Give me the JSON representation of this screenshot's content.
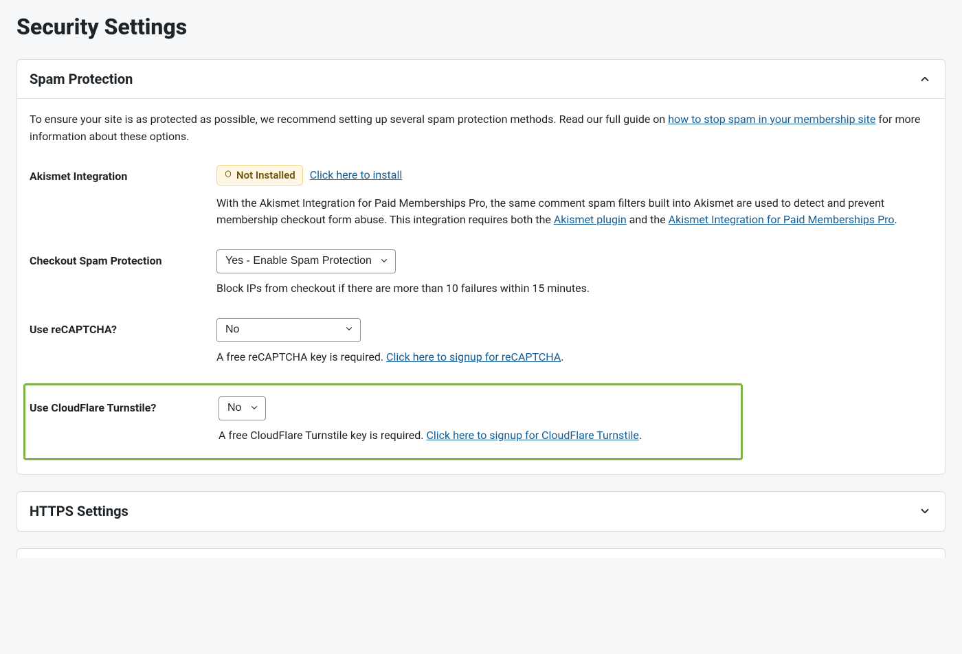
{
  "page": {
    "title": "Security Settings"
  },
  "spam_panel": {
    "title": "Spam Protection",
    "intro_before_link": "To ensure your site is as protected as possible, we recommend setting up several spam protection methods. Read our full guide on ",
    "intro_link": "how to stop spam in your membership site",
    "intro_after_link": " for more information about these options.",
    "akismet": {
      "label": "Akismet Integration",
      "badge": "Not Installed",
      "install_link": "Click here to install",
      "desc_before_a": "With the Akismet Integration for Paid Memberships Pro, the same comment spam filters built into Akismet are used to detect and prevent membership checkout form abuse. This integration requires both the ",
      "link_a": "Akismet plugin",
      "desc_between": " and the ",
      "link_b": "Akismet Integration for Paid Memberships Pro",
      "desc_after": "."
    },
    "checkout": {
      "label": "Checkout Spam Protection",
      "value": "Yes - Enable Spam Protection",
      "help": "Block IPs from checkout if there are more than 10 failures within 15 minutes."
    },
    "recaptcha": {
      "label": "Use reCAPTCHA?",
      "value": "No",
      "help_before": "A free reCAPTCHA key is required. ",
      "help_link": "Click here to signup for reCAPTCHA",
      "help_after": "."
    },
    "turnstile": {
      "label": "Use CloudFlare Turnstile?",
      "value": "No",
      "help_before": "A free CloudFlare Turnstile key is required. ",
      "help_link": "Click here to signup for CloudFlare Turnstile",
      "help_after": "."
    }
  },
  "https_panel": {
    "title": "HTTPS Settings"
  }
}
